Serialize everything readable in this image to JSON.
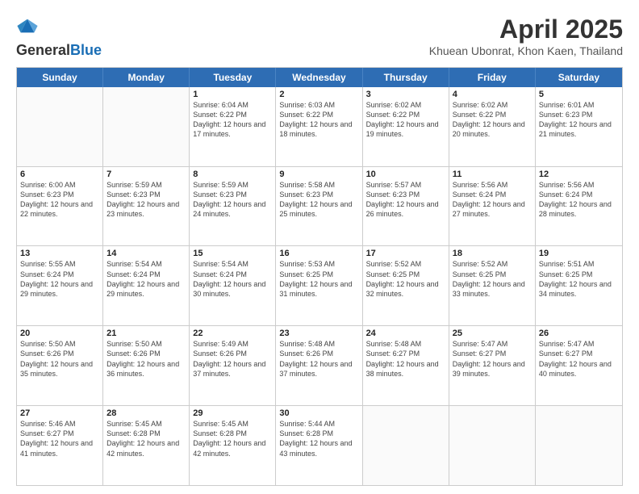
{
  "header": {
    "logo_line1": "General",
    "logo_line2": "Blue",
    "title": "April 2025",
    "subtitle": "Khuean Ubonrat, Khon Kaen, Thailand"
  },
  "days_of_week": [
    "Sunday",
    "Monday",
    "Tuesday",
    "Wednesday",
    "Thursday",
    "Friday",
    "Saturday"
  ],
  "weeks": [
    [
      {
        "day": "",
        "text": ""
      },
      {
        "day": "",
        "text": ""
      },
      {
        "day": "1",
        "text": "Sunrise: 6:04 AM\nSunset: 6:22 PM\nDaylight: 12 hours and 17 minutes."
      },
      {
        "day": "2",
        "text": "Sunrise: 6:03 AM\nSunset: 6:22 PM\nDaylight: 12 hours and 18 minutes."
      },
      {
        "day": "3",
        "text": "Sunrise: 6:02 AM\nSunset: 6:22 PM\nDaylight: 12 hours and 19 minutes."
      },
      {
        "day": "4",
        "text": "Sunrise: 6:02 AM\nSunset: 6:22 PM\nDaylight: 12 hours and 20 minutes."
      },
      {
        "day": "5",
        "text": "Sunrise: 6:01 AM\nSunset: 6:23 PM\nDaylight: 12 hours and 21 minutes."
      }
    ],
    [
      {
        "day": "6",
        "text": "Sunrise: 6:00 AM\nSunset: 6:23 PM\nDaylight: 12 hours and 22 minutes."
      },
      {
        "day": "7",
        "text": "Sunrise: 5:59 AM\nSunset: 6:23 PM\nDaylight: 12 hours and 23 minutes."
      },
      {
        "day": "8",
        "text": "Sunrise: 5:59 AM\nSunset: 6:23 PM\nDaylight: 12 hours and 24 minutes."
      },
      {
        "day": "9",
        "text": "Sunrise: 5:58 AM\nSunset: 6:23 PM\nDaylight: 12 hours and 25 minutes."
      },
      {
        "day": "10",
        "text": "Sunrise: 5:57 AM\nSunset: 6:23 PM\nDaylight: 12 hours and 26 minutes."
      },
      {
        "day": "11",
        "text": "Sunrise: 5:56 AM\nSunset: 6:24 PM\nDaylight: 12 hours and 27 minutes."
      },
      {
        "day": "12",
        "text": "Sunrise: 5:56 AM\nSunset: 6:24 PM\nDaylight: 12 hours and 28 minutes."
      }
    ],
    [
      {
        "day": "13",
        "text": "Sunrise: 5:55 AM\nSunset: 6:24 PM\nDaylight: 12 hours and 29 minutes."
      },
      {
        "day": "14",
        "text": "Sunrise: 5:54 AM\nSunset: 6:24 PM\nDaylight: 12 hours and 29 minutes."
      },
      {
        "day": "15",
        "text": "Sunrise: 5:54 AM\nSunset: 6:24 PM\nDaylight: 12 hours and 30 minutes."
      },
      {
        "day": "16",
        "text": "Sunrise: 5:53 AM\nSunset: 6:25 PM\nDaylight: 12 hours and 31 minutes."
      },
      {
        "day": "17",
        "text": "Sunrise: 5:52 AM\nSunset: 6:25 PM\nDaylight: 12 hours and 32 minutes."
      },
      {
        "day": "18",
        "text": "Sunrise: 5:52 AM\nSunset: 6:25 PM\nDaylight: 12 hours and 33 minutes."
      },
      {
        "day": "19",
        "text": "Sunrise: 5:51 AM\nSunset: 6:25 PM\nDaylight: 12 hours and 34 minutes."
      }
    ],
    [
      {
        "day": "20",
        "text": "Sunrise: 5:50 AM\nSunset: 6:26 PM\nDaylight: 12 hours and 35 minutes."
      },
      {
        "day": "21",
        "text": "Sunrise: 5:50 AM\nSunset: 6:26 PM\nDaylight: 12 hours and 36 minutes."
      },
      {
        "day": "22",
        "text": "Sunrise: 5:49 AM\nSunset: 6:26 PM\nDaylight: 12 hours and 37 minutes."
      },
      {
        "day": "23",
        "text": "Sunrise: 5:48 AM\nSunset: 6:26 PM\nDaylight: 12 hours and 37 minutes."
      },
      {
        "day": "24",
        "text": "Sunrise: 5:48 AM\nSunset: 6:27 PM\nDaylight: 12 hours and 38 minutes."
      },
      {
        "day": "25",
        "text": "Sunrise: 5:47 AM\nSunset: 6:27 PM\nDaylight: 12 hours and 39 minutes."
      },
      {
        "day": "26",
        "text": "Sunrise: 5:47 AM\nSunset: 6:27 PM\nDaylight: 12 hours and 40 minutes."
      }
    ],
    [
      {
        "day": "27",
        "text": "Sunrise: 5:46 AM\nSunset: 6:27 PM\nDaylight: 12 hours and 41 minutes."
      },
      {
        "day": "28",
        "text": "Sunrise: 5:45 AM\nSunset: 6:28 PM\nDaylight: 12 hours and 42 minutes."
      },
      {
        "day": "29",
        "text": "Sunrise: 5:45 AM\nSunset: 6:28 PM\nDaylight: 12 hours and 42 minutes."
      },
      {
        "day": "30",
        "text": "Sunrise: 5:44 AM\nSunset: 6:28 PM\nDaylight: 12 hours and 43 minutes."
      },
      {
        "day": "",
        "text": ""
      },
      {
        "day": "",
        "text": ""
      },
      {
        "day": "",
        "text": ""
      }
    ]
  ]
}
